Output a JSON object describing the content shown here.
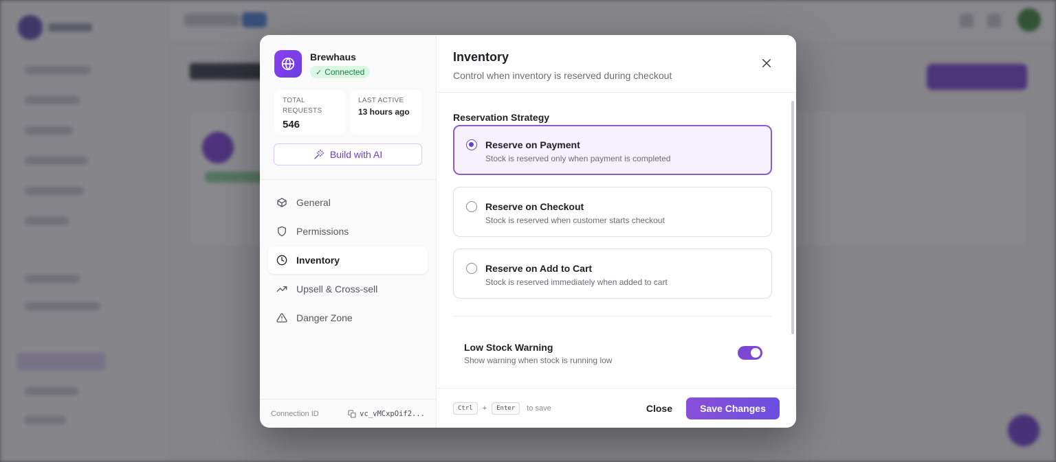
{
  "app": {
    "name": "Brewhaus",
    "status": "Connected",
    "icon": "globe-icon",
    "accent": "#7a48d2"
  },
  "stats": {
    "total_requests_label": "TOTAL REQUESTS",
    "total_requests_value": "546",
    "last_active_label": "LAST ACTIVE",
    "last_active_value": "13 hours ago"
  },
  "ai_button": {
    "label": "Build with AI",
    "icon": "magic-wand-icon"
  },
  "nav": {
    "items": [
      {
        "label": "General",
        "icon": "box-icon",
        "active": false
      },
      {
        "label": "Permissions",
        "icon": "shield-icon",
        "active": false
      },
      {
        "label": "Inventory",
        "icon": "clock-icon",
        "active": true
      },
      {
        "label": "Upsell & Cross-sell",
        "icon": "trending-up-icon",
        "active": false
      },
      {
        "label": "Danger Zone",
        "icon": "warning-icon",
        "active": false
      }
    ]
  },
  "connection": {
    "label": "Connection ID",
    "id": "vc_vMCxpOif2..."
  },
  "panel": {
    "title": "Inventory",
    "subtitle": "Control when inventory is reserved during checkout"
  },
  "reservation": {
    "label": "Reservation Strategy",
    "options": [
      {
        "title": "Reserve on Payment",
        "desc": "Stock is reserved only when payment is completed",
        "selected": true
      },
      {
        "title": "Reserve on Checkout",
        "desc": "Stock is reserved when customer starts checkout",
        "selected": false
      },
      {
        "title": "Reserve on Add to Cart",
        "desc": "Stock is reserved immediately when added to cart",
        "selected": false
      }
    ]
  },
  "low_stock": {
    "title": "Low Stock Warning",
    "desc": "Show warning when stock is running low",
    "enabled": true
  },
  "footer": {
    "key1": "Ctrl",
    "plus": "+",
    "key2": "Enter",
    "hint": "to save",
    "close_label": "Close",
    "save_label": "Save Changes"
  }
}
